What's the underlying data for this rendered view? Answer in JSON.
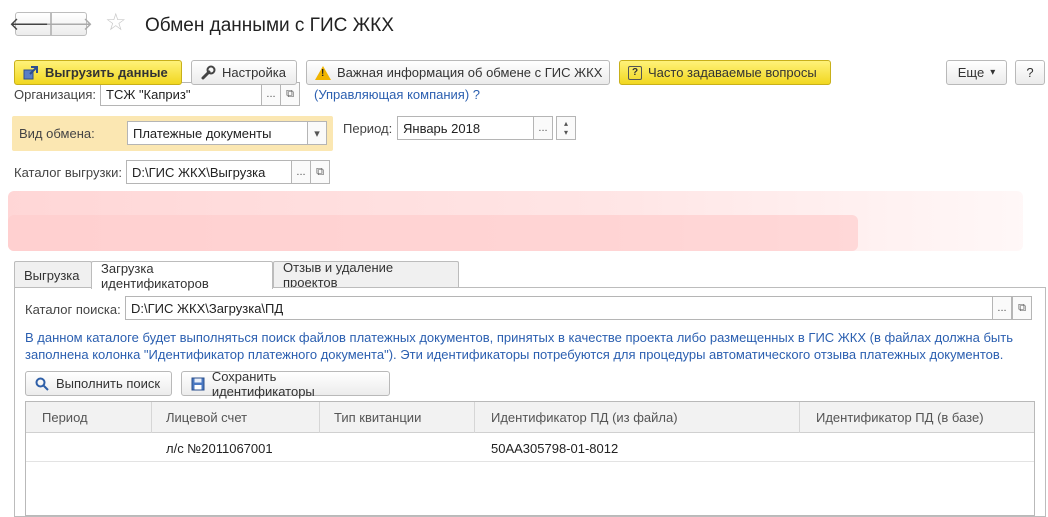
{
  "header": {
    "title": "Обмен данными с ГИС ЖКХ",
    "back_glyph": "🡐",
    "fwd_glyph": "🡒",
    "star_glyph": "☆"
  },
  "toolbar": {
    "upload_label": "Выгрузить данные",
    "settings_label": "Настройка",
    "important_info_label": "Важная информация об обмене с ГИС ЖКХ",
    "faq_label": "Часто задаваемые вопросы",
    "more_label": "Еще",
    "more_arrow": "▾",
    "help_label": "?"
  },
  "form": {
    "org_label": "Организация:",
    "org_value": "ТСЖ \"Каприз\"",
    "org_note": "(Управляющая компания) ?",
    "exchange_type_label": "Вид обмена:",
    "exchange_type_value": "Платежные документы",
    "period_label": "Период:",
    "period_value": "Январь 2018",
    "catalog_label": "Каталог выгрузки:",
    "catalog_value": "D:\\ГИС ЖКХ\\Выгрузка",
    "dots": "...",
    "dropdown_arrow": "▾",
    "open_glyph": "⧉",
    "spin_up": "▴",
    "spin_down": "▾"
  },
  "tabs": [
    {
      "label": "Выгрузка"
    },
    {
      "label": "Загрузка идентификаторов"
    },
    {
      "label": "Отзыв и удаление проектов"
    }
  ],
  "load_tab": {
    "search_catalog_label": "Каталог поиска:",
    "search_catalog_value": "D:\\ГИС ЖКХ\\Загрузка\\ПД",
    "info_text": "В данном каталоге будет выполняться поиск файлов платежных документов, принятых в качестве проекта либо размещенных в ГИС ЖКХ (в файлах должна быть заполнена колонка \"Идентификатор платежного документа\"). Эти идентификаторы потребуются для процедуры автоматического отзыва платежных документов.",
    "search_button": "Выполнить поиск",
    "save_ids_button": "Сохранить идентификаторы"
  },
  "table": {
    "columns": [
      "Период",
      "Лицевой счет",
      "Тип квитанции",
      "Идентификатор ПД (из файла)",
      "Идентификатор ПД (в базе)"
    ],
    "rows": [
      {
        "period": "",
        "account": "л/с №2011067001",
        "receipt_type": "",
        "id_file": "50АА305798-01-8012",
        "id_db": ""
      }
    ]
  },
  "colors": {
    "accent_yellow": "#f5e03a",
    "highlight_bg": "#fbe7b2",
    "info_text": "#2b5fb0"
  }
}
